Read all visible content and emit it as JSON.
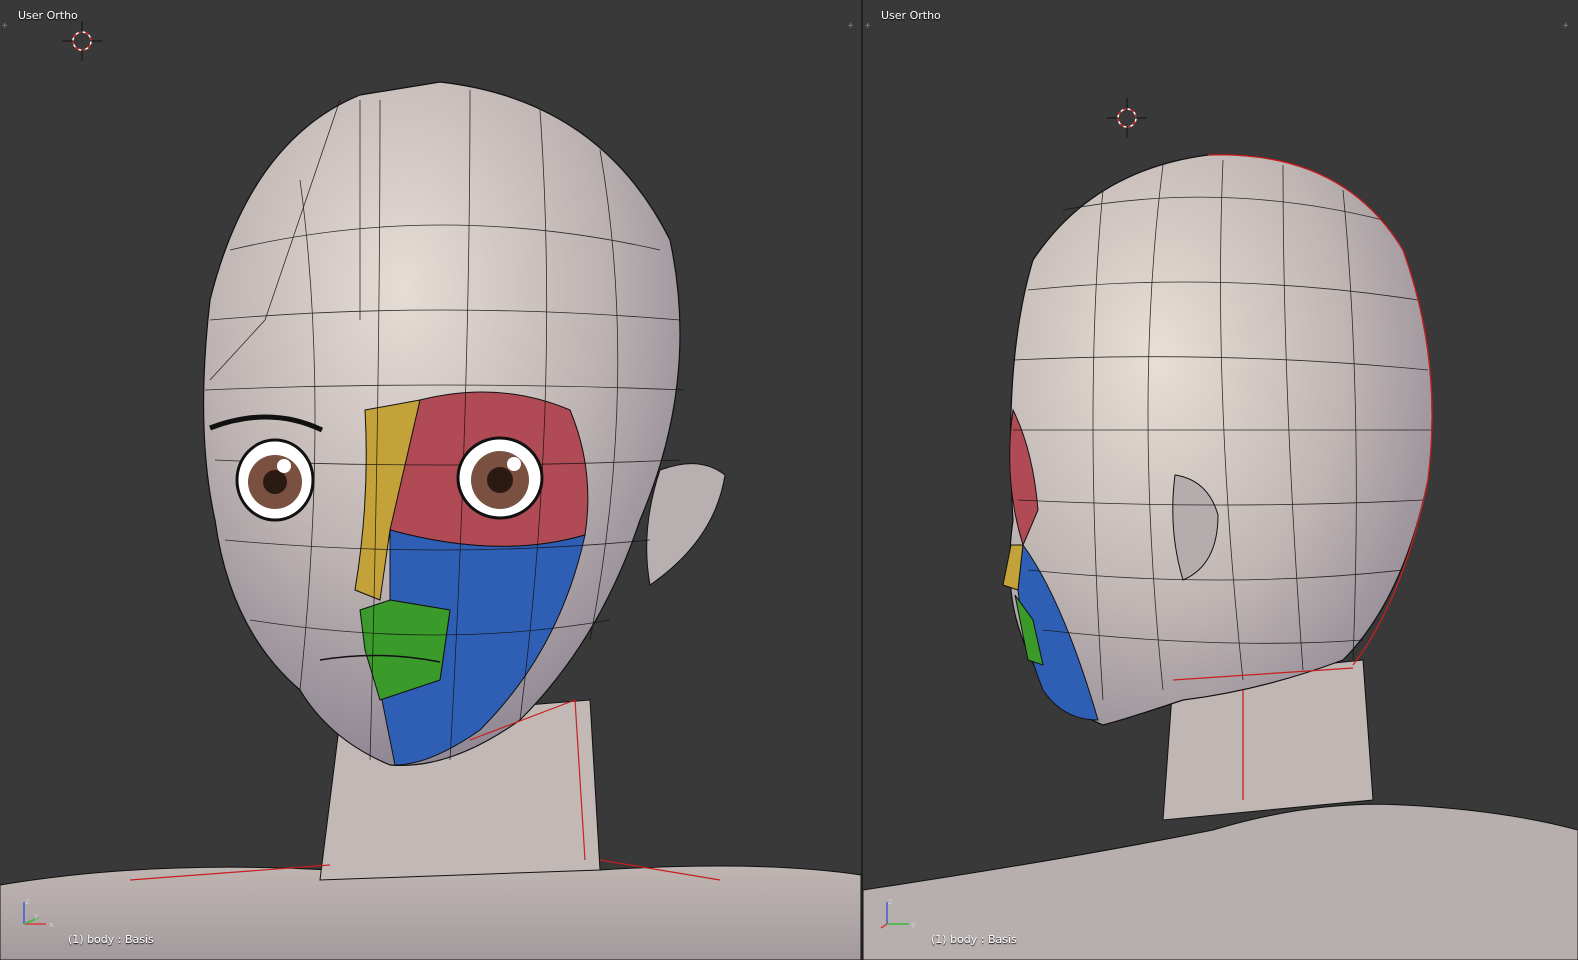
{
  "viewports": [
    {
      "id": "left",
      "title": "User Ortho",
      "status": "(1) body : Basis",
      "view": "front-three-quarter"
    },
    {
      "id": "right",
      "title": "User Ortho",
      "status": "(1) body : Basis",
      "view": "side-rear"
    }
  ],
  "axis_labels": {
    "x": "x",
    "y": "y",
    "z": "z"
  },
  "colors": {
    "background": "#393939",
    "mesh_fill": "#c8bfbf",
    "wire": "#111111",
    "seam": "#c81e1e",
    "region_red": "#b04a55",
    "region_yellow": "#c4a23a",
    "region_blue": "#2f5fb5",
    "region_green": "#3a9a2a",
    "cursor_red": "#d82a2a"
  },
  "icons": [
    "3d-cursor-icon",
    "axis-gizmo-icon",
    "area-split-icon"
  ]
}
